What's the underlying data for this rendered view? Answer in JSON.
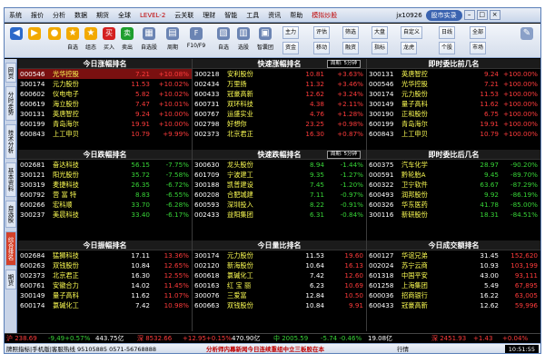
{
  "menubar": {
    "items": [
      "系统",
      "报价",
      "分析",
      "数据",
      "期货",
      "全球",
      "LEVEL-2",
      "云关联",
      "理财",
      "智能",
      "工具",
      "资讯",
      "帮助"
    ],
    "highlight": "模拟炒股",
    "user": "jx10926",
    "wbtn": "股市实录"
  },
  "toolbar": {
    "buttons": [
      {
        "label": "",
        "icon": "◀"
      },
      {
        "label": "",
        "icon": "▶"
      },
      {
        "label": "",
        "icon": "●"
      },
      {
        "label": "自选",
        "icon": "★"
      },
      {
        "label": "组态",
        "icon": "★"
      },
      {
        "label": "买入",
        "icon": "买"
      },
      {
        "label": "卖出",
        "icon": "卖"
      },
      {
        "label": "自选股",
        "icon": "▦"
      },
      {
        "label": "周期",
        "icon": "▤"
      },
      {
        "label": "F10/F9",
        "icon": "F"
      },
      {
        "label": "自选",
        "icon": "▧"
      },
      {
        "label": "选股",
        "icon": "▥"
      },
      {
        "label": "智囊团",
        "icon": "▣"
      }
    ],
    "combo": [
      "主力",
      "资金",
      "评估",
      "移动",
      "筛选",
      "融资",
      "全部",
      "市场"
    ],
    "group2": [
      "大盘",
      "指标",
      "自定义",
      "龙虎",
      "日线",
      "个股"
    ]
  },
  "lefttabs": [
    "网页",
    "分时走势",
    "技术分析",
    "基本资料",
    "自选股",
    "综合排名",
    "期货"
  ],
  "panels": [
    {
      "title": "今日涨幅排名",
      "badge": "",
      "rows": [
        [
          "000546",
          "光华控股",
          "7.21",
          "+10.08%"
        ],
        [
          "300174",
          "元力股份",
          "11.53",
          "+10.02%"
        ],
        [
          "600602",
          "仪电电子",
          "5.82",
          "+10.02%"
        ],
        [
          "600619",
          "海立股份",
          "7.47",
          "+10.01%"
        ],
        [
          "300131",
          "英唐智控",
          "9.24",
          "+10.00%"
        ],
        [
          "600199",
          "青岛海尔",
          "19.91",
          "+10.00%"
        ],
        [
          "600843",
          "上工申贝",
          "10.79",
          "+9.99%"
        ]
      ]
    },
    {
      "title": "快速涨幅排名",
      "badge": "周期: 5分钟",
      "rows": [
        [
          "300218",
          "安利股份",
          "10.81",
          "+3.63%"
        ],
        [
          "002434",
          "万里扬",
          "11.32",
          "+3.46%"
        ],
        [
          "600433",
          "冠豪高新",
          "12.62",
          "+3.24%"
        ],
        [
          "600731",
          "双环科技",
          "4.38",
          "+2.11%"
        ],
        [
          "600767",
          "运盛实业",
          "4.76",
          "+1.28%"
        ],
        [
          "002798",
          "好想你",
          "23.25",
          "+0.98%"
        ],
        [
          "002373",
          "北京君正",
          "16.30",
          "+0.87%"
        ]
      ]
    },
    {
      "title": "即时委比前几名",
      "badge": "",
      "rows": [
        [
          "300131",
          "英唐智控",
          "9.24",
          "+100.00%"
        ],
        [
          "000546",
          "光华控股",
          "7.21",
          "+100.00%"
        ],
        [
          "300174",
          "元力股份",
          "11.53",
          "+100.00%"
        ],
        [
          "300149",
          "量子高科",
          "11.62",
          "+100.00%"
        ],
        [
          "300190",
          "正和股份",
          "6.75",
          "+100.00%"
        ],
        [
          "600199",
          "青岛海尔",
          "19.91",
          "+100.00%"
        ],
        [
          "600843",
          "上工申贝",
          "10.79",
          "+100.00%"
        ]
      ]
    },
    {
      "title": "今日跌幅排名",
      "badge": "",
      "rows": [
        [
          "002681",
          "奋达科技",
          "56.15",
          "-7.75%"
        ],
        [
          "300121",
          "阳光股份",
          "35.72",
          "-7.58%"
        ],
        [
          "300319",
          "麦捷科技",
          "26.35",
          "-6.72%"
        ],
        [
          "600792",
          "营 富 特",
          "8.83",
          "-6.55%"
        ],
        [
          "600266",
          "宏科顺",
          "33.70",
          "-6.28%"
        ],
        [
          "300237",
          "美晨科技",
          "33.40",
          "-6.17%"
        ],
        [
          "",
          "",
          "",
          ""
        ]
      ]
    },
    {
      "title": "快速跌幅排名",
      "badge": "周期: 5分钟",
      "rows": [
        [
          "300630",
          "龙头股份",
          "8.94",
          "-1.44%"
        ],
        [
          "601709",
          "宁波建工",
          "9.35",
          "-1.27%"
        ],
        [
          "300188",
          "凯普建设",
          "7.45",
          "-1.20%"
        ],
        [
          "600208",
          "合肥城建",
          "7.11",
          "-0.97%"
        ],
        [
          "600593",
          "深圳投入",
          "8.22",
          "-0.91%"
        ],
        [
          "002433",
          "益阳集团",
          "6.31",
          "-0.84%"
        ],
        [
          "",
          "",
          "",
          ""
        ]
      ]
    },
    {
      "title": "即时委比后几名",
      "badge": "",
      "rows": [
        [
          "600375",
          "汽车化学",
          "28.97",
          "-90.20%"
        ],
        [
          "000591",
          "黔轮胎A",
          "9.45",
          "-89.70%"
        ],
        [
          "600322",
          "卫宁软件",
          "63.67",
          "-87.29%"
        ],
        [
          "600493",
          "润邦股份",
          "9.92",
          "-86.19%"
        ],
        [
          "600326",
          "华东医药",
          "41.78",
          "-85.00%"
        ],
        [
          "300116",
          "新研股份",
          "18.31",
          "-84.51%"
        ],
        [
          "",
          "",
          "",
          ""
        ]
      ]
    },
    {
      "title": "今日振幅排名",
      "badge": "",
      "rows": [
        [
          "002684",
          "猛狮科技",
          "17.11",
          "13.36%"
        ],
        [
          "600263",
          "双钱股份",
          "10.84",
          "12.65%"
        ],
        [
          "002373",
          "北京君正",
          "16.30",
          "12.55%"
        ],
        [
          "600761",
          "安徽合力",
          "14.02",
          "11.45%"
        ],
        [
          "300149",
          "量子高科",
          "11.62",
          "11.07%"
        ],
        [
          "600174",
          "氯碱化工",
          "7.42",
          "10.98%"
        ],
        [
          "",
          "",
          "",
          ""
        ]
      ]
    },
    {
      "title": "今日量比排名",
      "badge": "",
      "rows": [
        [
          "300174",
          "元力股份",
          "11.53",
          "19.60"
        ],
        [
          "002120",
          "新海股份",
          "10.64",
          "16.13"
        ],
        [
          "600618",
          "氯碱化工",
          "7.42",
          "12.60"
        ],
        [
          "600163",
          "红 宝 丽",
          "6.23",
          "10.69"
        ],
        [
          "300076",
          "三爱富",
          "12.84",
          "10.50"
        ],
        [
          "600663",
          "双钱股份",
          "10.84",
          "9.91"
        ],
        [
          "",
          "",
          "",
          ""
        ]
      ]
    },
    {
      "title": "今日成交额排名",
      "badge": "",
      "rows": [
        [
          "600127",
          "华谊兄弟",
          "31.45",
          "152,620"
        ],
        [
          "002024",
          "苏宁云商",
          "10.93",
          "103,199"
        ],
        [
          "601318",
          "中国平安",
          "43.00",
          "93,111"
        ],
        [
          "601258",
          "上海集团",
          "5.49",
          "67,895"
        ],
        [
          "600036",
          "招商银行",
          "16.22",
          "63,005"
        ],
        [
          "600433",
          "冠豪高新",
          "12.62",
          "59,996"
        ],
        [
          "",
          "",
          "",
          ""
        ]
      ]
    }
  ],
  "ticker": {
    "a": "沪 238.69",
    "b": "-9,49+0.57%",
    "c": "443.75亿",
    "d": "深 8532.66",
    "e": "+12.95+0.15%",
    "f": "470.90亿",
    "g": "中 2005.59",
    "h": "-5.74 -0.46%",
    "i": "19.08亿",
    "j": "深 2451.93",
    "k": "+1.43",
    "l": "+0.04%"
  },
  "status": {
    "left": "牌照指标|手机版|客服热线 95105885 0571-56768888",
    "scroll": "分析师内幕新闻今日连续重组中立三板股在本",
    "right": "行情",
    "clock": "10:51:55"
  },
  "colors": {
    "up": "#ff3b3b",
    "down": "#37d437",
    "name": "#ffff54",
    "code": "#ffffff"
  }
}
